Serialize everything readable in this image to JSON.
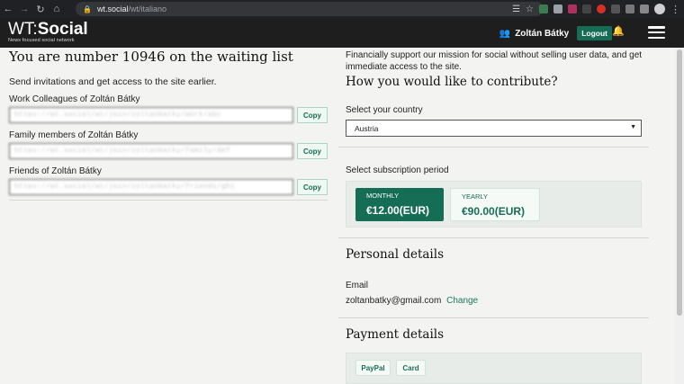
{
  "browser": {
    "url_host": "wt.social",
    "url_path": "/wt/italiano"
  },
  "header": {
    "logo_wt": "WT:",
    "logo_social": "Social",
    "tagline": "News focused social network",
    "user_name": "Zoltán Bátky",
    "logout_label": "Logout"
  },
  "left": {
    "title": "You are number 10946 on the waiting list",
    "intro": "Send invitations and get access to the site earlier.",
    "invites": [
      {
        "label": "Work Colleagues of Zoltán Bátky",
        "value": "https://wt.social/wt/join/zoltanbatky/work/abc",
        "copy": "Copy"
      },
      {
        "label": "Family members of Zoltán Bátky",
        "value": "https://wt.social/wt/join/zoltanbatky/family/def",
        "copy": "Copy"
      },
      {
        "label": "Friends of Zoltán Bátky",
        "value": "https://wt.social/wt/join/zoltanbatky/friends/ghi",
        "copy": "Copy"
      }
    ]
  },
  "right": {
    "support_text": "Financially support our mission for social without selling user data, and get immediate access to the site.",
    "contribute_title": "How you would like to contribute?",
    "country_label": "Select your country",
    "country_selected": "Austria",
    "subscription_label": "Select subscription period",
    "plans": [
      {
        "name": "MONTHLY",
        "price": "€12.00(EUR)"
      },
      {
        "name": "YEARLY",
        "price": "€90.00(EUR)"
      }
    ],
    "personal_title": "Personal details",
    "email_label": "Email",
    "email_value": "zoltanbatky@gmail.com",
    "email_change": "Change",
    "payment_title": "Payment details",
    "payment_methods": [
      "PayPal",
      "Card"
    ]
  },
  "colors": {
    "brand_green": "#166d55",
    "header_bg": "#1e1e1e",
    "page_bg": "#f3f4f2"
  }
}
